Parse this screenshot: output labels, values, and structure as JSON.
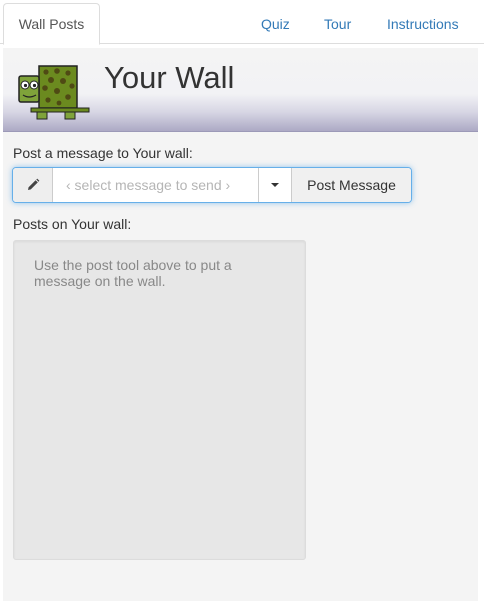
{
  "nav": {
    "tabs": [
      {
        "label": "Wall Posts",
        "active": true
      },
      {
        "label": "Quiz",
        "active": false
      },
      {
        "label": "Tour",
        "active": false
      },
      {
        "label": "Instructions",
        "active": false
      }
    ]
  },
  "banner": {
    "logo_icon": "turtle-icon",
    "title": "Your Wall"
  },
  "post_tool": {
    "label": "Post a message to Your wall:",
    "pencil_icon": "pencil-icon",
    "select_placeholder": "‹ select message to send ›",
    "dropdown_icon": "caret-down-icon",
    "submit_label": "Post Message"
  },
  "posts": {
    "label": "Posts on Your wall:",
    "empty_text": "Use the post tool above to put a message on the wall."
  },
  "colors": {
    "link": "#337ab7",
    "focus_border": "#66afe9",
    "banner_gradient_end": "#aaa7c3",
    "turtle_shell": "#6b8a1f",
    "turtle_spots": "#4f4a14"
  }
}
